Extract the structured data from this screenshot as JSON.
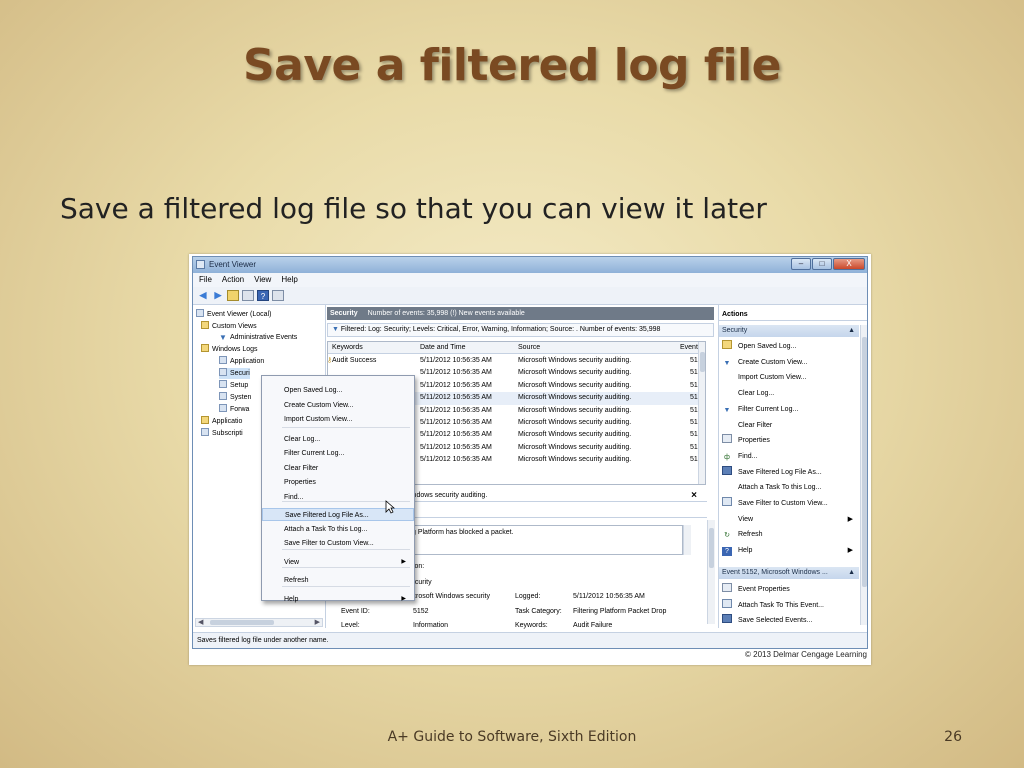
{
  "slide": {
    "title": "Save a filtered log file",
    "subtitle": "Save a filtered log file so that you can view it later",
    "footer": "A+ Guide to Software, Sixth Edition",
    "page_number": "26"
  },
  "window": {
    "title": "Event Viewer",
    "controls": {
      "minimize": "–",
      "maximize": "□",
      "close": "X"
    },
    "menu": [
      "File",
      "Action",
      "View",
      "Help"
    ]
  },
  "tree": [
    {
      "label": "Event Viewer (Local)",
      "icon": "computer-icon"
    },
    {
      "label": "Custom Views",
      "icon": "folder-icon"
    },
    {
      "label": "Administrative Events",
      "icon": "filter-icon"
    },
    {
      "label": "Windows Logs",
      "icon": "folder-icon"
    },
    {
      "label": "Application",
      "icon": "log-icon"
    },
    {
      "label": "Securi",
      "icon": "log-icon"
    },
    {
      "label": "Setup",
      "icon": "log-icon"
    },
    {
      "label": "Systen",
      "icon": "log-icon"
    },
    {
      "label": "Forwa",
      "icon": "log-icon"
    },
    {
      "label": "Applicatio",
      "icon": "folder-icon"
    },
    {
      "label": "Subscripti",
      "icon": "subscription-icon"
    }
  ],
  "center": {
    "header_name": "Security",
    "header_info": "Number of events: 35,998 (!) New events available",
    "filter_text": "Filtered: Log: Security; Levels: Critical, Error, Warning, Information; Source: . Number of events: 35,998",
    "columns": [
      "Keywords",
      "Date and Time",
      "Source",
      "Event"
    ],
    "rows": [
      {
        "keywords": "Audit Success",
        "date": "5/11/2012 10:56:35 AM",
        "source": "Microsoft Windows security auditing.",
        "event": "51"
      },
      {
        "keywords": "",
        "date": "5/11/2012 10:56:35 AM",
        "source": "Microsoft Windows security auditing.",
        "event": "51"
      },
      {
        "keywords": "",
        "date": "5/11/2012 10:56:35 AM",
        "source": "Microsoft Windows security auditing.",
        "event": "51"
      },
      {
        "keywords": "",
        "date": "5/11/2012 10:56:35 AM",
        "source": "Microsoft Windows security auditing.",
        "event": "51"
      },
      {
        "keywords": "",
        "date": "5/11/2012 10:56:35 AM",
        "source": "Microsoft Windows security auditing.",
        "event": "51"
      },
      {
        "keywords": "",
        "date": "5/11/2012 10:56:35 AM",
        "source": "Microsoft Windows security auditing.",
        "event": "51"
      },
      {
        "keywords": "",
        "date": "5/11/2012 10:56:35 AM",
        "source": "Microsoft Windows security auditing.",
        "event": "51"
      },
      {
        "keywords": "",
        "date": "5/11/2012 10:56:35 AM",
        "source": "Microsoft Windows security auditing.",
        "event": "51"
      },
      {
        "keywords": "",
        "date": "5/11/2012 10:56:35 AM",
        "source": "Microsoft Windows security auditing.",
        "event": "51"
      }
    ],
    "detail_header": "indows security auditing.",
    "detail_close": "×",
    "detail_desc": "g Platform has blocked a packet.",
    "detail_tion": "tion:",
    "detail_security": "ecurity",
    "detail_source": "icrosoft Windows security",
    "logged_label": "Logged:",
    "logged_value": "5/11/2012 10:56:35 AM",
    "event_id_label": "Event ID:",
    "event_id_value": "5152",
    "task_category_label": "Task Category:",
    "task_category_value": "Filtering Platform Packet Drop",
    "level_label": "Level:",
    "level_value": "Information",
    "keywords_label": "Keywords:",
    "keywords_value": "Audit Failure"
  },
  "context_menu": [
    {
      "label": "Open Saved Log...",
      "submenu": false
    },
    {
      "label": "Create Custom View...",
      "submenu": false
    },
    {
      "label": "Import Custom View...",
      "submenu": false
    },
    {
      "label": "Clear Log...",
      "submenu": false
    },
    {
      "label": "Filter Current Log...",
      "submenu": false
    },
    {
      "label": "Clear Filter",
      "submenu": false
    },
    {
      "label": "Properties",
      "submenu": false
    },
    {
      "label": "Find...",
      "submenu": false
    },
    {
      "label": "Save Filtered Log File As...",
      "submenu": false,
      "hover": true
    },
    {
      "label": "Attach a Task To this Log...",
      "submenu": false
    },
    {
      "label": "Save Filter to Custom View...",
      "submenu": false
    },
    {
      "label": "View",
      "submenu": true
    },
    {
      "label": "Refresh",
      "submenu": false
    },
    {
      "label": "Help",
      "submenu": true
    }
  ],
  "actions": {
    "title": "Actions",
    "section1": "Security",
    "items1": [
      {
        "label": "Open Saved Log...",
        "icon": "folder-icon"
      },
      {
        "label": "Create Custom View...",
        "icon": "filter-icon"
      },
      {
        "label": "Import Custom View...",
        "icon": ""
      },
      {
        "label": "Clear Log...",
        "icon": ""
      },
      {
        "label": "Filter Current Log...",
        "icon": "filter-icon"
      },
      {
        "label": "Clear Filter",
        "icon": ""
      },
      {
        "label": "Properties",
        "icon": "properties-icon"
      },
      {
        "label": "Find...",
        "icon": "binoculars-icon"
      },
      {
        "label": "Save Filtered Log File As...",
        "icon": "save-icon"
      },
      {
        "label": "Attach a Task To this Log...",
        "icon": ""
      },
      {
        "label": "Save Filter to Custom View...",
        "icon": "save-filter-icon"
      },
      {
        "label": "View",
        "icon": "",
        "submenu": true
      },
      {
        "label": "Refresh",
        "icon": "refresh-icon"
      },
      {
        "label": "Help",
        "icon": "help-icon",
        "submenu": true
      }
    ],
    "section2": "Event 5152, Microsoft Windows ...",
    "items2": [
      {
        "label": "Event Properties",
        "icon": "properties-icon"
      },
      {
        "label": "Attach Task To This Event...",
        "icon": "task-icon"
      },
      {
        "label": "Save Selected Events...",
        "icon": "save-icon"
      }
    ]
  },
  "status_text": "Saves filtered log file under another name.",
  "copyright": "© 2013 Delmar Cengage Learning"
}
